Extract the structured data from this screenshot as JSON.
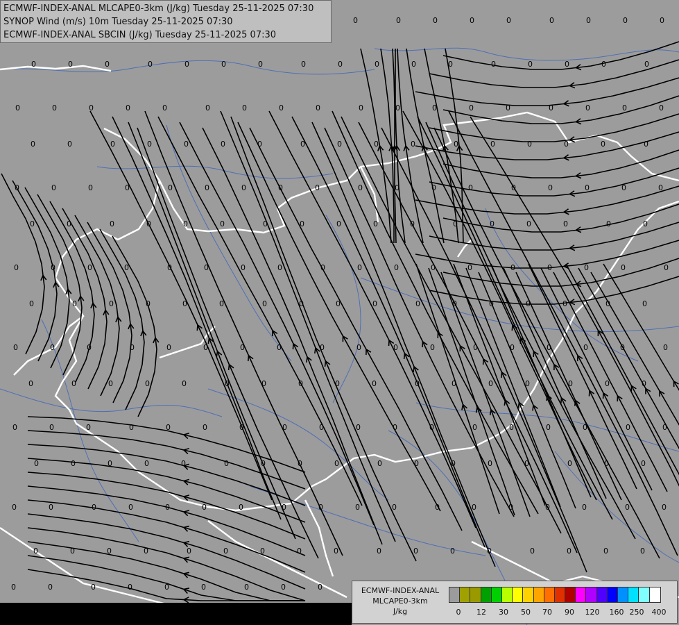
{
  "titles": {
    "line1": "ECMWF-INDEX-ANAL MLCAPE0-3km (J/kg) Tuesday 25-11-2025 07:30",
    "line2": "SYNOP Wind (m/s) 10m Tuesday 25-11-2025 07:30",
    "line3": "ECMWF-INDEX-ANAL SBCIN (J/kg) Tuesday 25-11-2025 07:30"
  },
  "legend": {
    "line1": "ECMWF-INDEX-ANAL",
    "line2": "MLCAPE0-3km",
    "line3": "J/kg",
    "colors": [
      "#9c9c9c",
      "#a0a000",
      "#9a9a00",
      "#00a000",
      "#00d000",
      "#b8ff00",
      "#ffff00",
      "#ffd200",
      "#ffa500",
      "#ff7000",
      "#e03000",
      "#b00000",
      "#ff00ff",
      "#b000ff",
      "#5000ff",
      "#0000ff",
      "#0090ff",
      "#00e0ff",
      "#80ffff",
      "#ffffff"
    ],
    "ticks": [
      "0",
      "12",
      "30",
      "50",
      "70",
      "90",
      "120",
      "160",
      "250",
      "400"
    ]
  },
  "map": {
    "field_value": "0",
    "background_color": "#9c9c9c",
    "border_color": "#ffffff",
    "river_color": "#4f6fb5",
    "streamline_color": "#000000"
  }
}
